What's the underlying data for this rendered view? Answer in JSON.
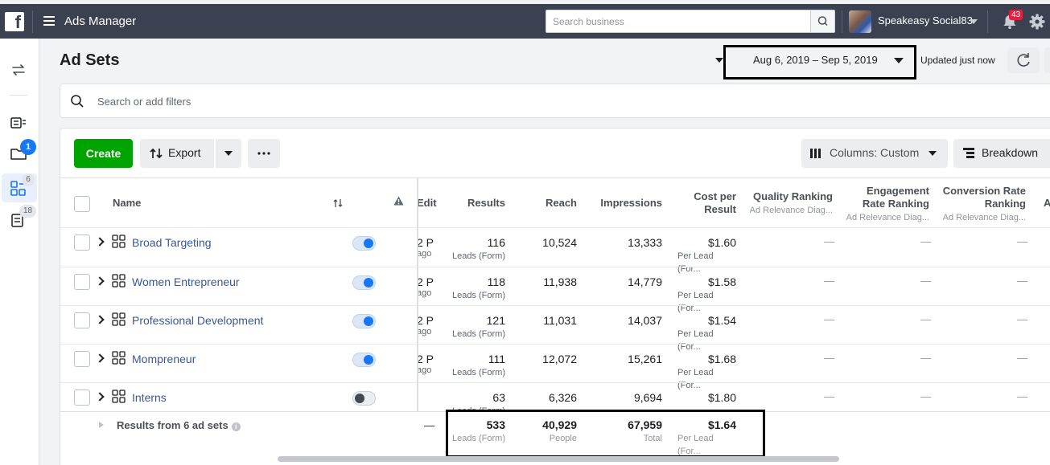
{
  "topbar": {
    "logo": "f",
    "app_title": "Ads Manager",
    "search_placeholder": "Search business",
    "account_name": "Speakeasy Social83",
    "notification_count": "43"
  },
  "rail": {
    "campaigns_badge": "1",
    "adsets_badge": "6",
    "ads_badge": "18"
  },
  "header": {
    "title": "Ad Sets",
    "date_range": "Aug 6, 2019 – Sep 5, 2019",
    "updated": "Updated just now"
  },
  "filter": {
    "placeholder": "Search or add filters"
  },
  "toolbar": {
    "create": "Create",
    "export": "Export",
    "columns": "Columns: Custom",
    "breakdown": "Breakdown"
  },
  "table": {
    "headers": {
      "name": "Name",
      "edit": "Edit",
      "results": "Results",
      "reach": "Reach",
      "impressions": "Impressions",
      "cost_line1": "Cost per",
      "cost_line2": "Result",
      "quality": "Quality Ranking",
      "quality_sub": "Ad Relevance Diag...",
      "engagement_line1": "Engagement",
      "engagement_line2": "Rate Ranking",
      "engagement_sub": "Ad Relevance Diag...",
      "conversion_line1": "Conversion Rate",
      "conversion_line2": "Ranking",
      "conversion_sub": "Ad Relevance Diag...",
      "next_col": "A"
    },
    "rows": [
      {
        "name": "Broad Targeting",
        "active": true,
        "edit": "2 P",
        "edit_sub": "ago",
        "results": "116",
        "results_sub": "Leads (Form)",
        "reach": "10,524",
        "impressions": "13,333",
        "cost": "$1.60",
        "cost_sub": "Per Lead (For...",
        "dash": "—"
      },
      {
        "name": "Women Entrepreneur",
        "active": true,
        "edit": "2 P",
        "edit_sub": "ago",
        "results": "118",
        "results_sub": "Leads (Form)",
        "reach": "11,938",
        "impressions": "14,779",
        "cost": "$1.58",
        "cost_sub": "Per Lead (For...",
        "dash": "—"
      },
      {
        "name": "Professional Development",
        "active": true,
        "edit": "2 P",
        "edit_sub": "ago",
        "results": "121",
        "results_sub": "Leads (Form)",
        "reach": "11,031",
        "impressions": "14,037",
        "cost": "$1.54",
        "cost_sub": "Per Lead (For...",
        "dash": "—"
      },
      {
        "name": "Mompreneur",
        "active": true,
        "edit": "2 P",
        "edit_sub": "ago",
        "results": "111",
        "results_sub": "Leads (Form)",
        "reach": "12,072",
        "impressions": "15,261",
        "cost": "$1.68",
        "cost_sub": "Per Lead (For...",
        "dash": "—"
      },
      {
        "name": "Interns",
        "active": false,
        "edit": "",
        "edit_sub": "",
        "results": "63",
        "results_sub": "Leads (Form)",
        "reach": "6,326",
        "impressions": "9,694",
        "cost": "$1.80",
        "cost_sub": "",
        "dash": "—"
      }
    ],
    "summary": {
      "label": "Results from 6 ad sets",
      "edit": "—",
      "results": "533",
      "results_sub": "Leads (Form)",
      "reach": "40,929",
      "reach_sub": "People",
      "impressions": "67,959",
      "impressions_sub": "Total",
      "cost": "$1.64",
      "cost_sub": "Per Lead (For..."
    }
  }
}
